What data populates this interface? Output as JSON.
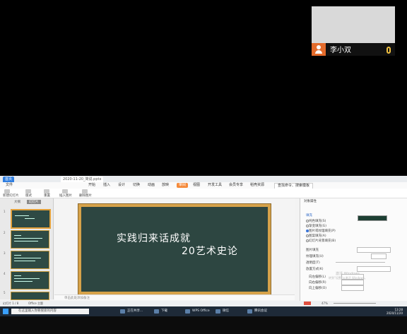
{
  "participant": {
    "name": "李小双"
  },
  "app": {
    "tabs": [
      "首页",
      "2020-11-20_简说.pptx"
    ],
    "menu": [
      "文件",
      "开始",
      "插入",
      "设计",
      "切换",
      "动画",
      "放映",
      "审阅",
      "视图",
      "开发工具",
      "会员专享",
      "稻壳资源",
      "查找命令、搜索模板"
    ],
    "ribbon_labels": [
      "新建幻灯片",
      "版式",
      "重置",
      "插入图片",
      "删除图片"
    ]
  },
  "sidebar": {
    "tabs": [
      "大纲",
      "幻灯片"
    ],
    "slide_numbers": [
      "1",
      "2",
      "3",
      "4",
      "5"
    ]
  },
  "slide": {
    "line1": "实践归来话成就",
    "line2": "20艺术史论"
  },
  "notes": {
    "placeholder": "单击此处添加备注"
  },
  "statusbar": {
    "left": "幻灯片 1 / 8",
    "theme": "Office 主题",
    "zoom": "47%"
  },
  "panel": {
    "title": "对象属性",
    "section": "填充",
    "options": [
      "纯色填充(S)",
      "渐变填充(G)",
      "图片或纹理填充(P)",
      "图案填充(A)",
      "幻灯片背景填充(B)"
    ],
    "fields": [
      "图片填充",
      "纹理填充(U)",
      "透明度(T)",
      "放置方式(K)",
      "向左偏移(L)",
      "向右偏移(R)",
      "向上偏移(O)"
    ],
    "watermark": "激活 Windows",
    "watermark_sub": "转到\"设置\"以激活 Windows。",
    "swatch_color": "#1d3f33"
  },
  "taskbar": {
    "search_placeholder": "在这里输入你要搜索的内容",
    "apps": [
      "正在共享...",
      "下载",
      "WPS Office",
      "微信",
      "腾讯会议"
    ],
    "time": "13:28",
    "date": "2020/11/20"
  }
}
